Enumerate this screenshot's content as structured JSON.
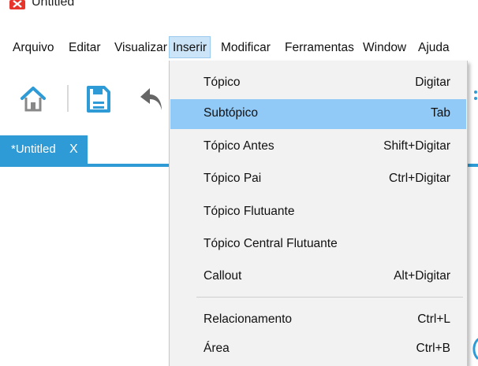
{
  "window": {
    "title": "Untitled",
    "logo_icon": "xmind-logo-icon",
    "accent_color": "#2e9bd6"
  },
  "menubar": {
    "items": [
      {
        "label": "Arquivo"
      },
      {
        "label": "Editar"
      },
      {
        "label": "Visualizar"
      },
      {
        "label": "Inserir",
        "active": true
      },
      {
        "label": "Modificar"
      },
      {
        "label": "Ferramentas"
      },
      {
        "label": "Window"
      },
      {
        "label": "Ajuda"
      }
    ]
  },
  "toolbar": {
    "icons": [
      "home-icon",
      "save-icon",
      "undo-icon"
    ]
  },
  "tabs": [
    {
      "label": "*Untitled",
      "close": "X",
      "active": true
    }
  ],
  "insert_menu": {
    "items": [
      {
        "label": "Tópico",
        "shortcut": "Digitar"
      },
      {
        "label": "Subtópico",
        "shortcut": "Tab",
        "highlighted": true
      },
      {
        "label": "Tópico Antes",
        "shortcut": "Shift+Digitar"
      },
      {
        "label": "Tópico Pai",
        "shortcut": "Ctrl+Digitar"
      },
      {
        "label": "Tópico Flutuante",
        "shortcut": ""
      },
      {
        "label": "Tópico Central Flutuante",
        "shortcut": ""
      },
      {
        "label": "Callout",
        "shortcut": "Alt+Digitar"
      },
      {
        "label": "Relacionamento",
        "shortcut": "Ctrl+L"
      },
      {
        "label": "Área",
        "shortcut": "Ctrl+B"
      }
    ],
    "highlight_color": "#91c9f7"
  }
}
